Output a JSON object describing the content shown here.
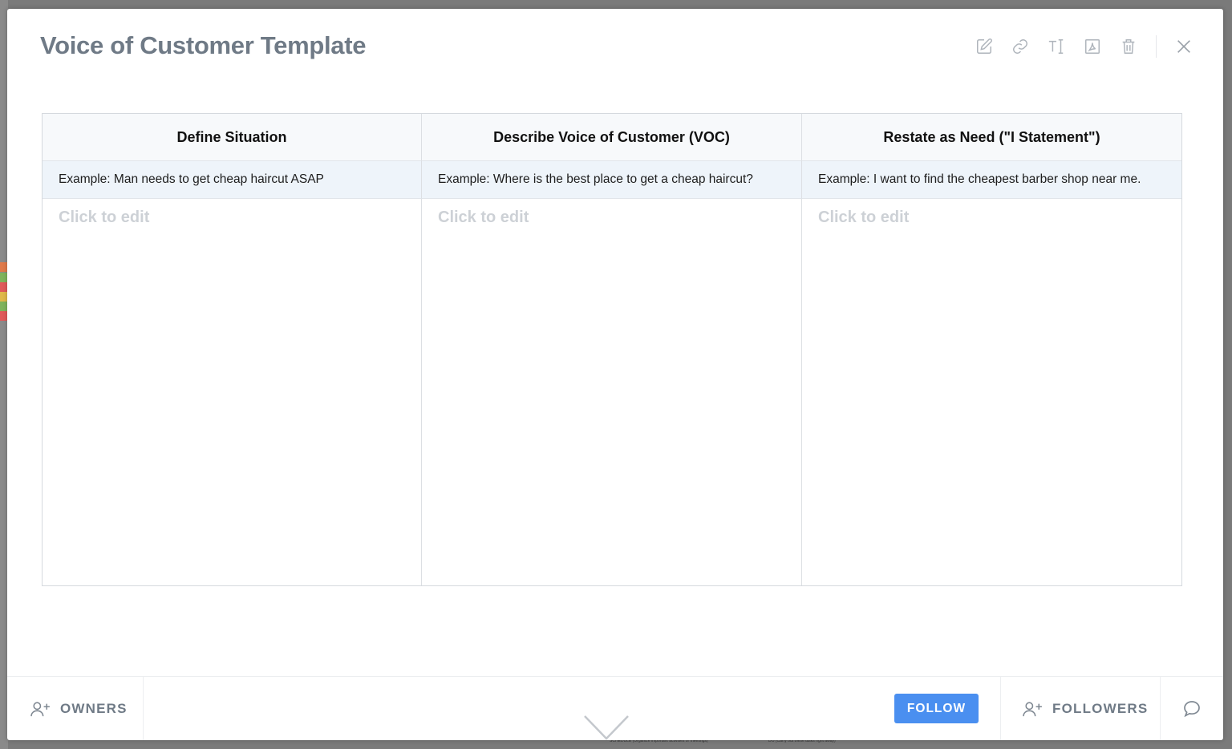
{
  "modal": {
    "title": "Voice of Customer Template"
  },
  "toolbar": {
    "icons": [
      "edit-icon",
      "link-icon",
      "text-format-icon",
      "pdf-icon",
      "trash-icon",
      "close-icon"
    ]
  },
  "table": {
    "headers": [
      "Define Situation",
      "Describe Voice of Customer (VOC)",
      "Restate as Need (\"I Statement\")"
    ],
    "example_row": [
      "Example: Man needs to get cheap haircut ASAP",
      "Example: Where is the best place to get a cheap haircut?",
      "Example: I want to find the cheapest barber shop near me."
    ],
    "placeholder": "Click to edit"
  },
  "footer": {
    "owners_label": "OWNERS",
    "follow_label": "FOLLOW",
    "followers_label": "FOLLOWERS"
  },
  "colors": {
    "title": "#6f7a86",
    "follow_button": "#4a8ff0",
    "placeholder": "#cdd1d6",
    "example_row_bg": "#eef4fa"
  },
  "background": {
    "bottom_texts": [
      "SCHEDULE (Organize important activities or meetings)",
      "DO (Carry out these tasks right away)"
    ]
  }
}
